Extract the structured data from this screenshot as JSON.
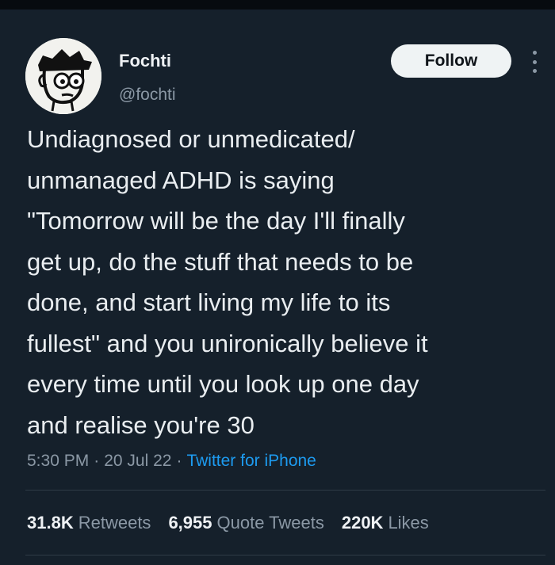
{
  "tweet": {
    "author": {
      "name": "Fochti",
      "handle": "@fochti",
      "avatar_icon": "cartoon-face-avatar"
    },
    "follow_label": "Follow",
    "more_icon": "more-options-icon",
    "text": "Undiagnosed or unmedicated/\nunmanaged ADHD is saying\n\"Tomorrow will be the day I'll finally\nget up, do the stuff that needs to be\ndone, and start living my life to its\nfullest\" and you unironically believe it\nevery time until you look up one day\nand realise you're 30",
    "time": "5:30 PM",
    "date": "20 Jul 22",
    "separator": "·",
    "source": "Twitter for iPhone",
    "stats": {
      "retweets_count": "31.8K",
      "retweets_label": "Retweets",
      "quotes_count": "6,955",
      "quotes_label": "Quote Tweets",
      "likes_count": "220K",
      "likes_label": "Likes"
    }
  },
  "colors": {
    "background": "#15202b",
    "text_primary": "#e7ecef",
    "text_secondary": "#8b98a5",
    "link": "#1d9bf0",
    "follow_button_bg": "#eff3f4"
  }
}
